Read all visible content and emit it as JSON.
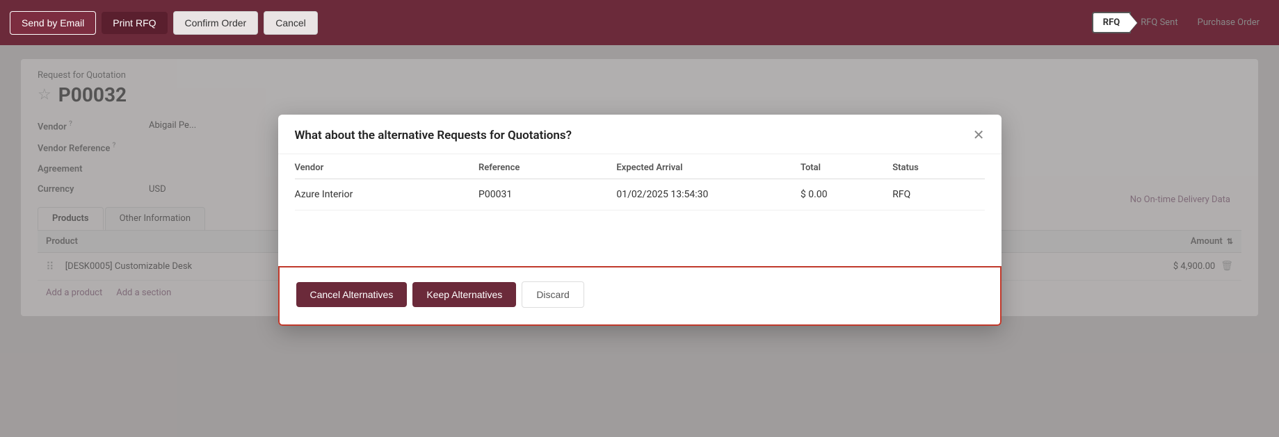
{
  "toolbar": {
    "send_email_label": "Send by Email",
    "print_rfq_label": "Print RFQ",
    "confirm_order_label": "Confirm Order",
    "cancel_label": "Cancel"
  },
  "status_bar": {
    "rfq_label": "RFQ",
    "rfq_sent_label": "RFQ Sent",
    "purchase_order_label": "Purchase Order"
  },
  "form": {
    "request_label": "Request for Quotation",
    "record_id": "P00032",
    "fields": [
      {
        "label": "Vendor",
        "superscript": "?",
        "value": "Abigail Pe..."
      },
      {
        "label": "Vendor Reference",
        "superscript": "?",
        "value": ""
      },
      {
        "label": "Agreement",
        "superscript": "",
        "value": ""
      },
      {
        "label": "Currency",
        "superscript": "",
        "value": "USD"
      }
    ]
  },
  "tabs": [
    {
      "label": "Products",
      "active": true
    },
    {
      "label": "Other Information",
      "active": false
    }
  ],
  "table": {
    "headers": [
      {
        "label": "Product"
      },
      {
        "label": "Amount"
      }
    ],
    "rows": [
      {
        "product": "[DESK0005] Customizable Desk",
        "amount": "$ 4,900.00"
      }
    ],
    "add_product": "Add a product",
    "add_section": "Add a section"
  },
  "no_delivery": "No On-time Delivery Data",
  "modal": {
    "title": "What about the alternative Requests for Quotations?",
    "table_headers": [
      "Vendor",
      "Reference",
      "Expected Arrival",
      "Total",
      "Status"
    ],
    "rows": [
      {
        "vendor": "Azure Interior",
        "reference": "P00031",
        "expected_arrival": "01/02/2025 13:54:30",
        "total": "$ 0.00",
        "status": "RFQ"
      }
    ],
    "cancel_alternatives_label": "Cancel Alternatives",
    "keep_alternatives_label": "Keep Alternatives",
    "discard_label": "Discard",
    "close_icon": "✕"
  }
}
